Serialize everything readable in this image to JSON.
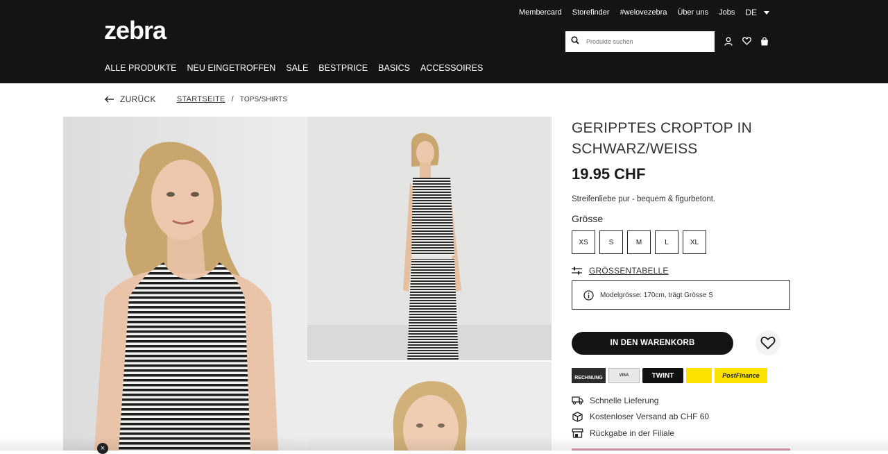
{
  "header": {
    "logo": "zebra",
    "top_links": [
      "Membercard",
      "Storefinder",
      "#welovezebra",
      "Über uns",
      "Jobs"
    ],
    "language": "DE",
    "search_placeholder": "Produkte suchen",
    "main_nav": [
      "ALLE PRODUKTE",
      "NEU EINGETROFFEN",
      "SALE",
      "BESTPRICE",
      "BASICS",
      "ACCESSOIRES"
    ]
  },
  "breadcrumb": {
    "back": "ZURÜCK",
    "home": "STARTSEITE",
    "separator": "/",
    "current": "TOPS/SHIRTS"
  },
  "product": {
    "title": "GERIPPTES CROPTOP IN SCHWARZ/WEISS",
    "price": "19.95 CHF",
    "description": "Streifenliebe pur - bequem & figurbetont.",
    "size_label": "Grösse",
    "sizes": [
      "XS",
      "S",
      "M",
      "L",
      "XL"
    ],
    "size_table_link": "GRÖSSENTABELLE",
    "model_info": "Modelgrösse: 170cm, trägt Grösse S",
    "add_to_cart": "IN DEN WARENKORB"
  },
  "payments": {
    "rechnung": "RECHNUNG",
    "card": "VISA",
    "twint": "TWINT",
    "postfinance": "PostFinance"
  },
  "usps": [
    {
      "icon": "truck-icon",
      "text": "Schnelle Lieferung"
    },
    {
      "icon": "package-icon",
      "text": "Kostenloser Versand ab CHF 60"
    },
    {
      "icon": "store-icon",
      "text": "Rückgabe in der Filiale"
    }
  ],
  "colors": {
    "header_bg": "#141414",
    "accent_pink": "#d79ab0",
    "postfinance_yellow": "#fde200"
  }
}
